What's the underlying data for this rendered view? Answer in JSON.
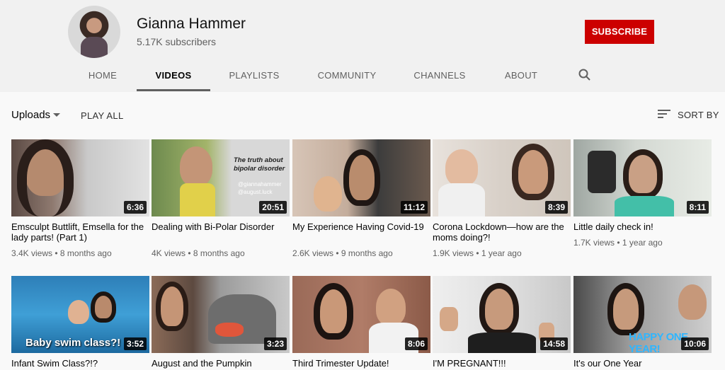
{
  "channel": {
    "name": "Gianna Hammer",
    "subscribers": "5.17K subscribers",
    "subscribe_label": "SUBSCRIBE"
  },
  "tabs": [
    "HOME",
    "VIDEOS",
    "PLAYLISTS",
    "COMMUNITY",
    "CHANNELS",
    "ABOUT"
  ],
  "active_tab": "VIDEOS",
  "toolbar": {
    "uploads_label": "Uploads",
    "play_all_label": "PLAY ALL",
    "sort_label": "SORT BY"
  },
  "videos": [
    {
      "title": "Emsculpt Buttlift, Emsella for the lady parts! (Part 1)",
      "views": "3.4K views",
      "age": "8 months ago",
      "duration": "6:36"
    },
    {
      "title": "Dealing with Bi-Polar Disorder",
      "views": "4K views",
      "age": "8 months ago",
      "duration": "20:51",
      "overlay": "The truth about bipolar disorder",
      "overlay_handles": "@giannahammer\n@august.luck"
    },
    {
      "title": "My Experience Having Covid-19",
      "views": "2.6K views",
      "age": "9 months ago",
      "duration": "11:12"
    },
    {
      "title": "Corona Lockdown—how are the moms doing?!",
      "views": "1.9K views",
      "age": "1 year ago",
      "duration": "8:39"
    },
    {
      "title": "Little daily check in!",
      "views": "1.7K views",
      "age": "1 year ago",
      "duration": "8:11"
    },
    {
      "title": "Infant Swim Class?!?",
      "views": "",
      "age": "",
      "duration": "3:52",
      "overlay": "Baby swim class?!"
    },
    {
      "title": "August and the Pumpkin",
      "views": "",
      "age": "",
      "duration": "3:23"
    },
    {
      "title": "Third Trimester Update!",
      "views": "",
      "age": "",
      "duration": "8:06"
    },
    {
      "title": "I'M PREGNANT!!!",
      "views": "",
      "age": "",
      "duration": "14:58"
    },
    {
      "title": "It's our One Year",
      "views": "",
      "age": "",
      "duration": "10:06",
      "overlay": "HAPPY ONE YEAR!"
    }
  ],
  "colors": {
    "brand_red": "#cc0000",
    "header_bg": "#f1f1f1",
    "page_bg": "#f9f9f9",
    "meta_text": "#606060"
  },
  "icons": {
    "search": "search-icon",
    "sort": "sort-icon",
    "dropdown": "caret-down-icon"
  }
}
